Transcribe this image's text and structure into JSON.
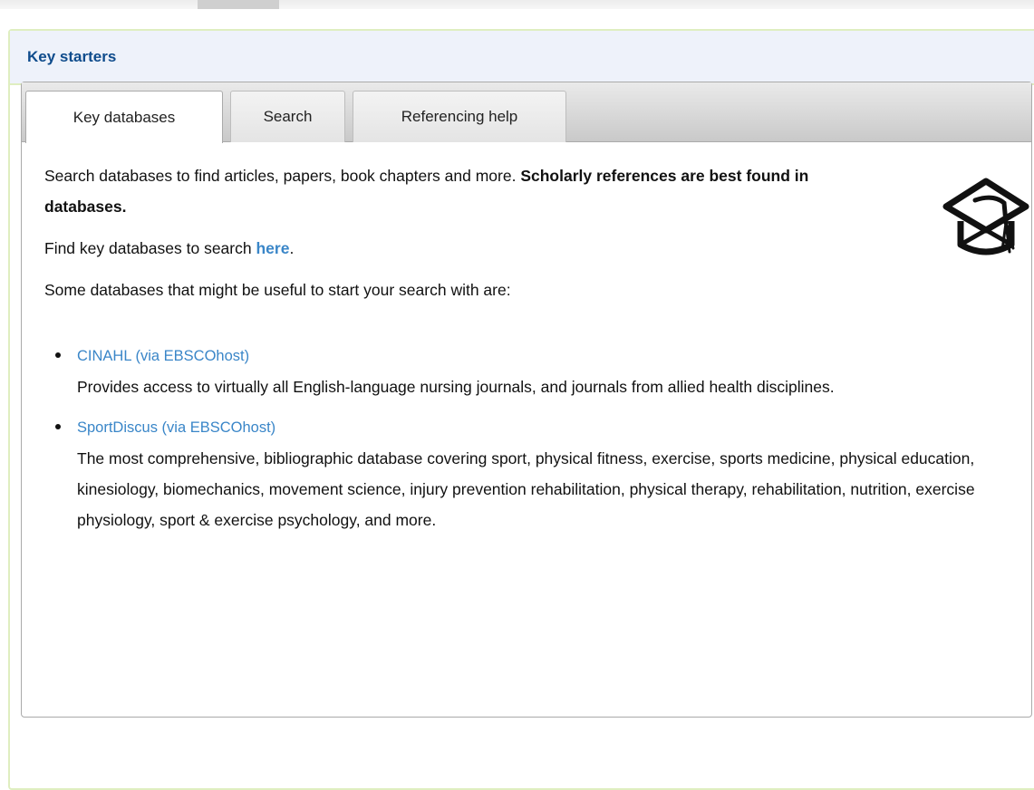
{
  "box": {
    "title": "Key starters"
  },
  "tabs": [
    {
      "label": "Key databases",
      "active": true
    },
    {
      "label": "Search",
      "active": false
    },
    {
      "label": "Referencing help",
      "active": false
    }
  ],
  "panel": {
    "intro_text": "Search databases to find articles, papers, book chapters and more. ",
    "intro_bold": "Scholarly references are best found in databases.",
    "find_prefix": "Find key databases to search ",
    "find_link": "here",
    "find_suffix": ".",
    "some_text": "Some databases that might be useful to start your search with are:",
    "databases": [
      {
        "name": "CINAHL (via EBSCOhost)",
        "description": "Provides access to virtually all English-language nursing journals, and journals from allied health disciplines."
      },
      {
        "name": "SportDiscus (via EBSCOhost)",
        "description": "The most comprehensive, bibliographic database covering sport, physical fitness, exercise, sports medicine, physical education, kinesiology, biomechanics, movement science, injury prevention rehabilitation, physical therapy, rehabilitation, nutrition, exercise physiology, sport & exercise psychology, and more."
      }
    ],
    "icon": "graduation-cap-icon"
  },
  "colors": {
    "title": "#0f4c8c",
    "link": "#3a86c8",
    "header_bg": "#eef2fa",
    "border_green": "#dfeec0"
  }
}
